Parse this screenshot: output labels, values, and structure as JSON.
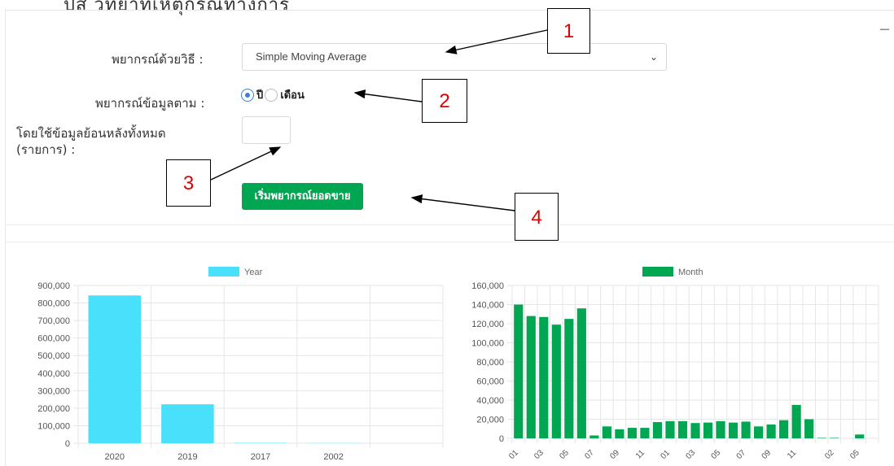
{
  "header_cut": "ปัส วิทยาที่เหตุกรณ์ทางการ",
  "form": {
    "method_label": "พยากรณ์ด้วยวิธี :",
    "method_value": "Simple Moving Average",
    "by_label": "พยากรณ์ข้อมูลตาม :",
    "radio_year": "ปี",
    "radio_month": "เดือน",
    "selected": "year",
    "history_label_1": "โดยใช้ข้อมูลย้อนหลังทั้งหมด",
    "history_label_2": "(รายการ) :",
    "history_value": "",
    "start_button": "เริ่มพยากรณ์ยอดขาย"
  },
  "callouts": [
    "1",
    "2",
    "3",
    "4"
  ],
  "colors": {
    "year": "#48e0fb",
    "month": "#00a651",
    "button": "#00a651",
    "callout_text": "#e00000"
  },
  "chart_data": [
    {
      "type": "bar",
      "legend": "Year",
      "categories": [
        "2020",
        "2019",
        "2017",
        "2002"
      ],
      "values": [
        843000,
        222000,
        2000,
        1000
      ],
      "yticks": [
        "0",
        "100,000",
        "200,000",
        "300,000",
        "400,000",
        "500,000",
        "600,000",
        "700,000",
        "800,000",
        "900,000"
      ],
      "ylim": [
        0,
        900000
      ],
      "grid": true,
      "legend_position": "top"
    },
    {
      "type": "bar",
      "legend": "Month",
      "categories": [
        "01",
        "02",
        "03",
        "04",
        "05",
        "06",
        "07",
        "08",
        "09",
        "10",
        "11",
        "12",
        "01",
        "02",
        "03",
        "04",
        "05",
        "06",
        "07",
        "08",
        "09",
        "10",
        "11",
        "12",
        "01",
        "02",
        "03",
        "04",
        "05"
      ],
      "values": [
        140000,
        128000,
        127000,
        119000,
        125000,
        136000,
        3000,
        12500,
        9500,
        11000,
        11000,
        17000,
        18000,
        18000,
        16000,
        16500,
        18000,
        16500,
        17500,
        12500,
        14500,
        19000,
        35000,
        20000,
        500,
        500,
        0,
        4000,
        0
      ],
      "yticks": [
        "0",
        "20,000",
        "40,000",
        "60,000",
        "80,000",
        "100,000",
        "120,000",
        "140,000",
        "160,000"
      ],
      "ylim": [
        0,
        160000
      ],
      "xtick_labels": [
        "01",
        "03",
        "05",
        "07",
        "09",
        "11",
        "01",
        "03",
        "05",
        "07",
        "09",
        "11",
        "02",
        "05"
      ],
      "grid": true,
      "legend_position": "top"
    }
  ]
}
